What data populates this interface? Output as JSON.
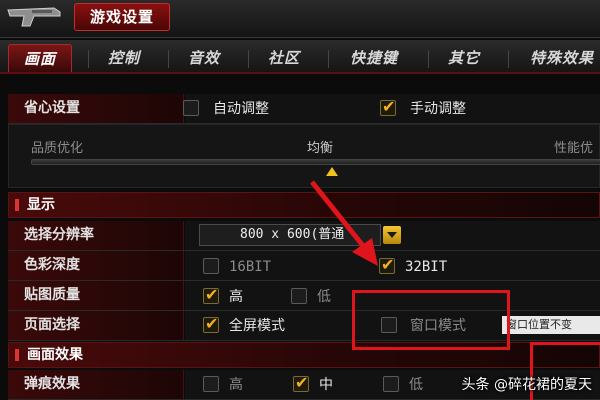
{
  "window": {
    "title": "游戏设置",
    "gun_icon": "pistol-icon"
  },
  "tabs": [
    {
      "label": "画面",
      "active": true
    },
    {
      "label": "控制",
      "active": false
    },
    {
      "label": "音效",
      "active": false
    },
    {
      "label": "社区",
      "active": false
    },
    {
      "label": "快捷键",
      "active": false
    },
    {
      "label": "其它",
      "active": false
    },
    {
      "label": "特殊效果",
      "active": false
    }
  ],
  "worry_free": {
    "label": "省心设置",
    "auto": {
      "label": "自动调整",
      "checked": false
    },
    "manual": {
      "label": "手动调整",
      "checked": true
    }
  },
  "quality": {
    "left_label": "品质优化",
    "mid_label": "均衡",
    "right_label": "性能优",
    "level": 0.5
  },
  "display": {
    "header": "显示",
    "resolution": {
      "label": "选择分辨率",
      "value": "800 x 600(普通"
    },
    "color_depth": {
      "label": "色彩深度",
      "option16": {
        "label": "16BIT",
        "checked": false
      },
      "option32": {
        "label": "32BIT",
        "checked": true
      }
    },
    "texture": {
      "label": "贴图质量",
      "high": {
        "label": "高",
        "checked": true
      },
      "low": {
        "label": "低",
        "checked": false
      }
    },
    "page_mode": {
      "label": "页面选择",
      "fullscreen": {
        "label": "全屏模式",
        "checked": true
      },
      "windowed": {
        "label": "窗口模式",
        "checked": false
      },
      "popup_note": "窗口位置不变"
    }
  },
  "effects": {
    "header": "画面效果",
    "bullet": {
      "label": "弹痕效果",
      "high": {
        "label": "高",
        "checked": false
      },
      "mid": {
        "label": "中",
        "checked": true
      },
      "low": {
        "label": "低",
        "checked": false
      }
    }
  },
  "watermark": "头条 @碎花裙的夏天",
  "colors": {
    "accent_red": "#8a1010",
    "check_yellow": "#f3b21a",
    "annotation_red": "#e0151b"
  }
}
